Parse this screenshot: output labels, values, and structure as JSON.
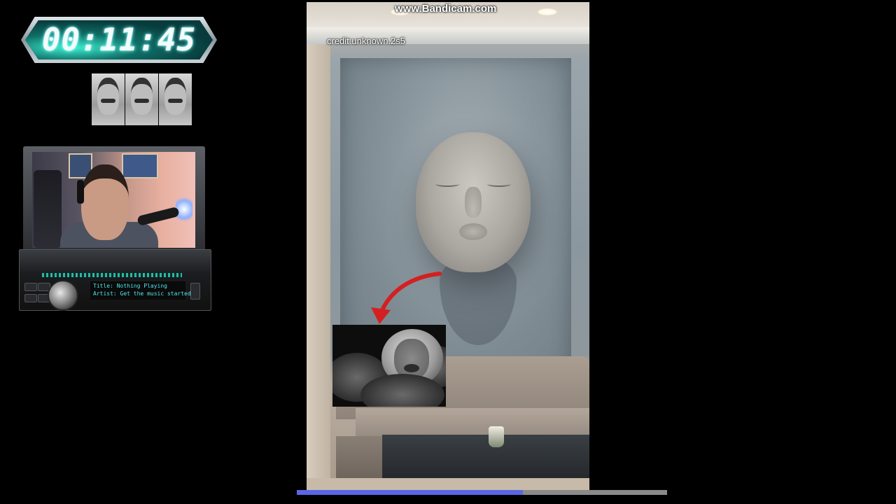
{
  "overlay": {
    "timer": "00:11:45",
    "radio": {
      "title_line": "Title: Nothing Playing",
      "artist_line": "Artist: Get the music started"
    }
  },
  "video": {
    "watermark": "www.Bandicam.com",
    "credit": "credit:unknown.2s5",
    "progress_fraction": 0.61
  },
  "colors": {
    "progress_played": "#5a66e6",
    "progress_track": "#8a8a8a",
    "arrow": "#d42020",
    "radio_text": "#4ee8ee"
  },
  "icons": {
    "arrow": "curved-arrow-icon"
  }
}
